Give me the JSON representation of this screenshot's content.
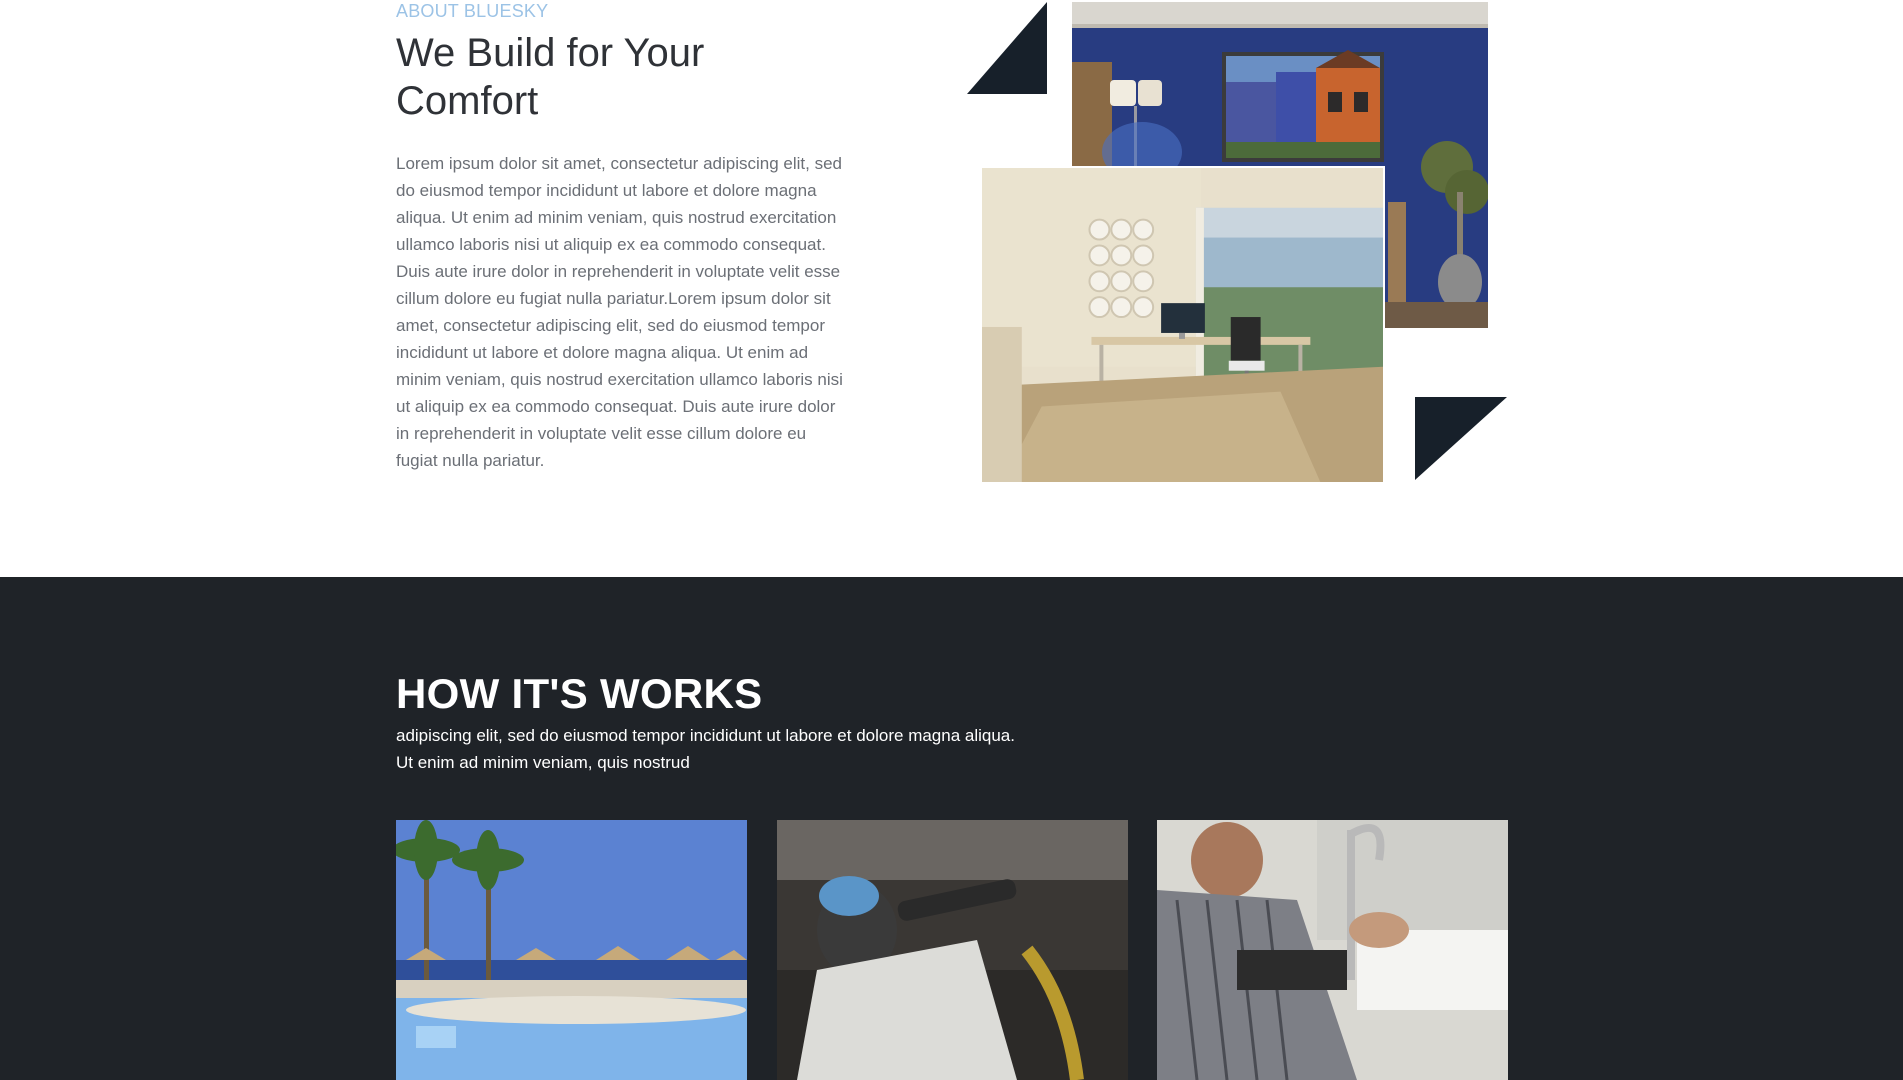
{
  "about": {
    "eyebrow": "ABOUT BLUESKY",
    "title": "We Build for Your Comfort",
    "body": "Lorem ipsum dolor sit amet, consectetur adipiscing elit, sed do eiusmod tempor incididunt ut labore et dolore magna aliqua. Ut enim ad minim veniam, quis nostrud exercitation ullamco laboris nisi ut aliquip ex ea commodo consequat. Duis aute irure dolor in reprehenderit in voluptate velit esse cillum dolore eu fugiat nulla pariatur.Lorem ipsum dolor sit amet, consectetur adipiscing elit, sed do eiusmod tempor incididunt ut labore et dolore magna aliqua. Ut enim ad minim veniam, quis nostrud exercitation ullamco laboris nisi ut aliquip ex ea commodo consequat. Duis aute irure dolor in reprehenderit in voluptate velit esse cillum dolore eu fugiat nulla pariatur."
  },
  "how": {
    "title": "HOW IT'S WORKS",
    "subtitle_line1": "adipiscing elit, sed do eiusmod tempor incididunt ut labore et dolore magna aliqua.",
    "subtitle_line2": "Ut enim ad minim veniam, quis nostrud"
  },
  "colors": {
    "accent": "#9cc3e6",
    "dark_section": "#1f2328",
    "triangle": "#17202a"
  }
}
